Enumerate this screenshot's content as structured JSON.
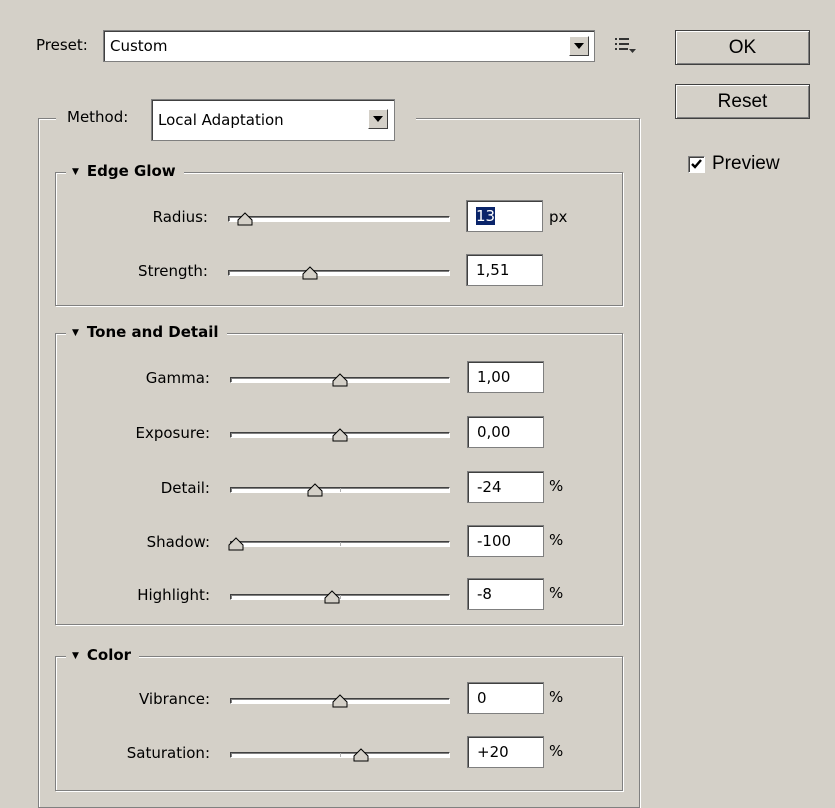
{
  "preset": {
    "label": "Preset:",
    "value": "Custom"
  },
  "buttons": {
    "ok": "OK",
    "reset": "Reset"
  },
  "preview": {
    "label": "Preview",
    "checked": true
  },
  "method": {
    "label": "Method:",
    "value": "Local Adaptation"
  },
  "edge_glow": {
    "title": "Edge Glow",
    "radius": {
      "label": "Radius:",
      "value": "13",
      "unit": "px",
      "slider_fraction": 0.05
    },
    "strength": {
      "label": "Strength:",
      "value": "1,51",
      "unit": "",
      "slider_fraction": 0.36
    }
  },
  "tone_detail": {
    "title": "Tone and Detail",
    "gamma": {
      "label": "Gamma:",
      "value": "1,00",
      "unit": "",
      "slider_fraction": 0.5
    },
    "exposure": {
      "label": "Exposure:",
      "value": "0,00",
      "unit": "",
      "slider_fraction": 0.5
    },
    "detail": {
      "label": "Detail:",
      "value": "-24",
      "unit": "%",
      "slider_fraction": 0.38
    },
    "shadow": {
      "label": "Shadow:",
      "value": "-100",
      "unit": "%",
      "slider_fraction": 0.0
    },
    "highlight": {
      "label": "Highlight:",
      "value": "-8",
      "unit": "%",
      "slider_fraction": 0.46
    }
  },
  "color": {
    "title": "Color",
    "vibrance": {
      "label": "Vibrance:",
      "value": "0",
      "unit": "%",
      "slider_fraction": 0.5
    },
    "saturation": {
      "label": "Saturation:",
      "value": "+20",
      "unit": "%",
      "slider_fraction": 0.6
    }
  }
}
